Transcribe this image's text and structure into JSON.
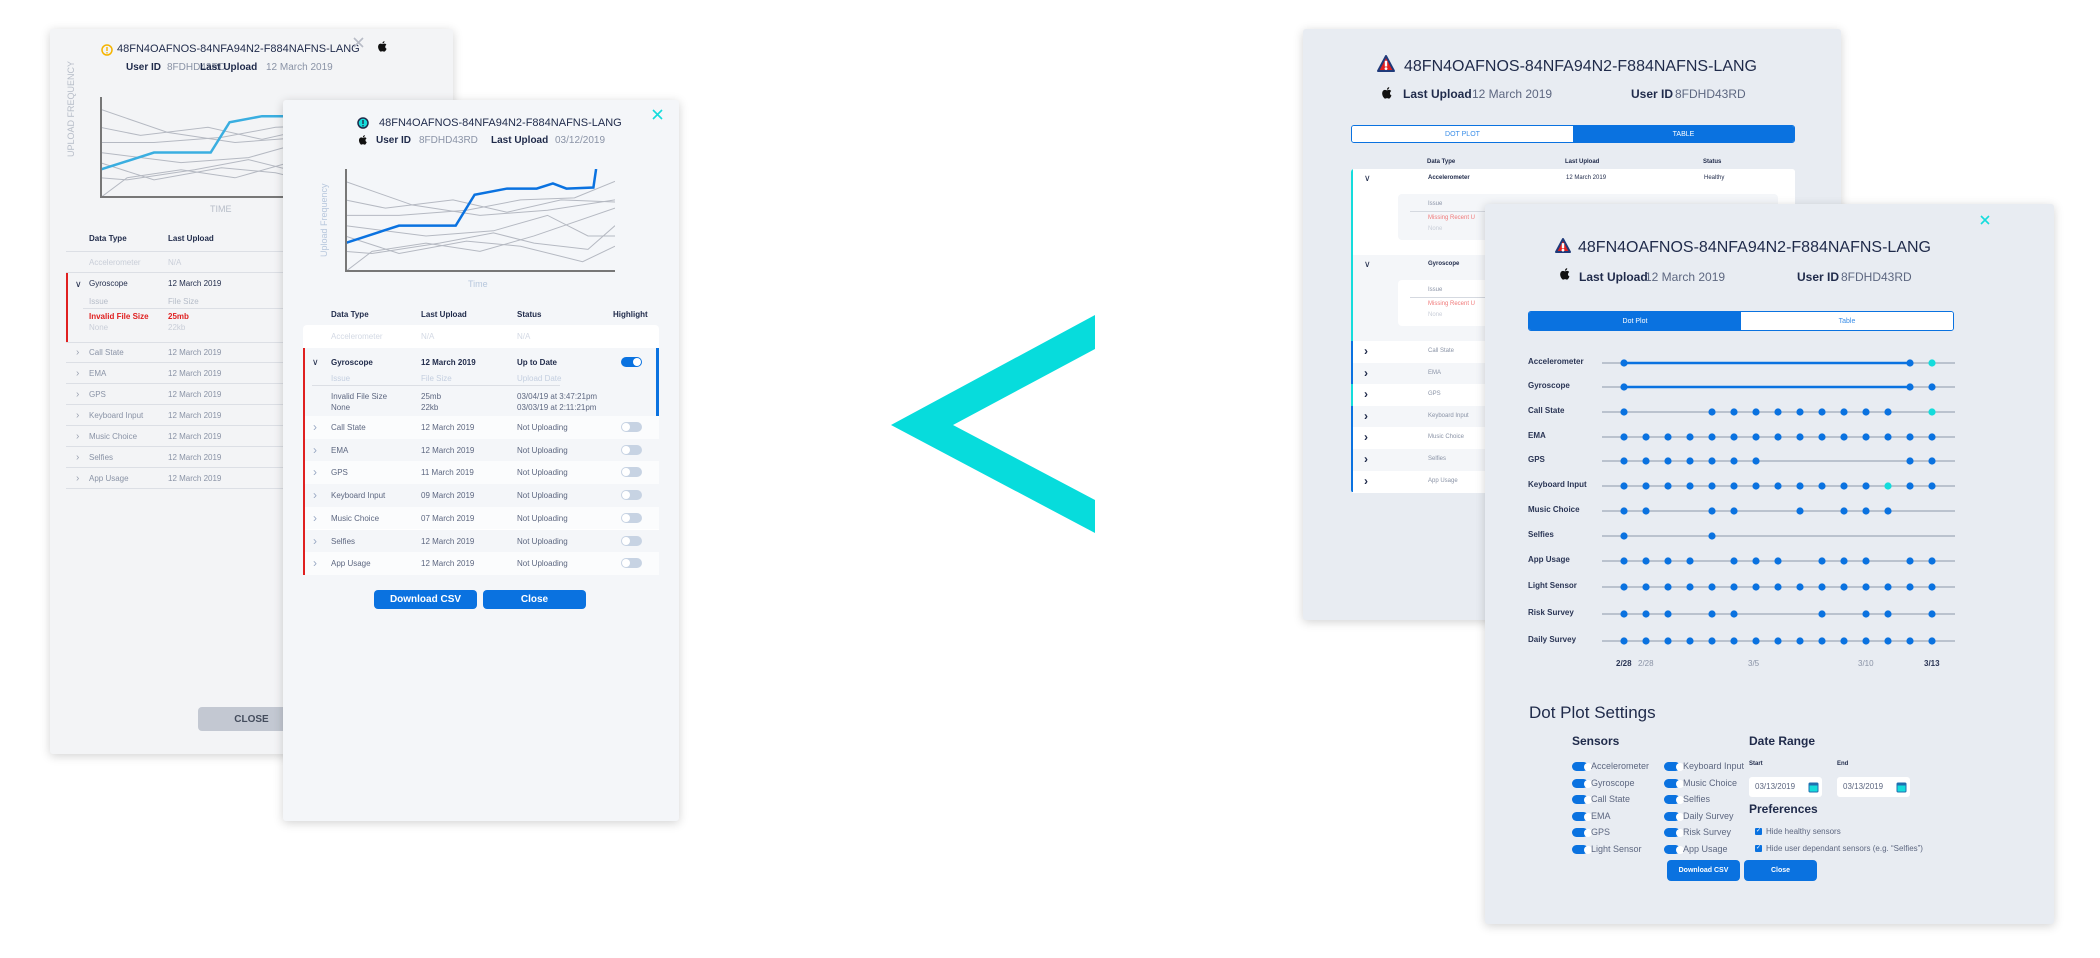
{
  "colors": {
    "accent": "#0a72e0",
    "teal": "#14dcdc",
    "error": "#e02020",
    "warning": "#f5b400",
    "navy": "#1f2a4a"
  },
  "old_design": {
    "back_card": {
      "device_id": "48FN4OAFNOS-84NFA94N2-F884NAFNS-LANG",
      "status_icon": "warning-circle-icon",
      "os_icon": "apple-icon",
      "user_id_label": "User ID",
      "user_id": "8FDHD43RD",
      "last_upload_label": "Last Upload",
      "last_upload": "12 March 2019",
      "chart_ylabel": "UPLOAD FREQUENCY",
      "chart_xlabel": "TIME",
      "columns": [
        "Data Type",
        "Last Upload"
      ],
      "disabled_row": {
        "type": "Accelerometer",
        "last_upload": "N/A"
      },
      "expanded_row": {
        "type": "Gyroscope",
        "last_upload": "12 March 2019",
        "sub_headers": [
          "Issue",
          "File Size"
        ],
        "details": [
          {
            "issue": "Invalid File Size",
            "size": "25mb"
          },
          {
            "issue": "None",
            "size": "22kb"
          }
        ]
      },
      "rows": [
        {
          "type": "Call State",
          "last_upload": "12 March 2019"
        },
        {
          "type": "EMA",
          "last_upload": "12 March 2019"
        },
        {
          "type": "GPS",
          "last_upload": "12 March 2019"
        },
        {
          "type": "Keyboard Input",
          "last_upload": "12 March 2019"
        },
        {
          "type": "Music Choice",
          "last_upload": "12 March 2019"
        },
        {
          "type": "Selfies",
          "last_upload": "12 March 2019"
        },
        {
          "type": "App Usage",
          "last_upload": "12 March 2019"
        }
      ],
      "close_label": "CLOSE"
    },
    "front_card": {
      "device_id": "48FN4OAFNOS-84NFA94N2-F884NAFNS-LANG",
      "status_icon": "alert-circle-icon",
      "os_icon": "apple-icon",
      "user_id_label": "User ID",
      "user_id": "8FDHD43RD",
      "last_upload_label": "Last Upload",
      "last_upload": "03/12/2019",
      "columns": [
        "Data Type",
        "Last Upload",
        "Status",
        "Highlight"
      ],
      "disabled_row": {
        "type": "Accelerometer",
        "last_upload": "N/A",
        "status": "N/A"
      },
      "expanded_row": {
        "type": "Gyroscope",
        "last_upload": "12 March 2019",
        "status": "Up to Date",
        "highlight": true,
        "sub_headers": [
          "Issue",
          "File Size",
          "Upload Date"
        ],
        "details": [
          {
            "issue": "Invalid File Size",
            "size": "25mb",
            "date": "03/04/19 at 3:47:21pm"
          },
          {
            "issue": "None",
            "size": "22kb",
            "date": "03/03/19 at 2:11:21pm"
          }
        ]
      },
      "rows": [
        {
          "type": "Call State",
          "last_upload": "12 March 2019",
          "status": "Not Uploading",
          "highlight": false
        },
        {
          "type": "EMA",
          "last_upload": "12 March 2019",
          "status": "Not Uploading",
          "highlight": false
        },
        {
          "type": "GPS",
          "last_upload": "11 March 2019",
          "status": "Not Uploading",
          "highlight": false
        },
        {
          "type": "Keyboard Input",
          "last_upload": "09 March 2019",
          "status": "Not Uploading",
          "highlight": false
        },
        {
          "type": "Music Choice",
          "last_upload": "07 March 2019",
          "status": "Not Uploading",
          "highlight": false
        },
        {
          "type": "Selfies",
          "last_upload": "12 March 2019",
          "status": "Not Uploading",
          "highlight": false
        },
        {
          "type": "App Usage",
          "last_upload": "12 March 2019",
          "status": "Not Uploading",
          "highlight": false
        }
      ],
      "download_label": "Download CSV",
      "close_label": "Close"
    }
  },
  "comparison_icon": "chevron-left-icon",
  "new_design": {
    "back_card": {
      "device_id": "48FN4OAFNOS-84NFA94N2-F884NAFNS-LANG",
      "status_icon": "warning-triangle-icon",
      "os_icon": "apple-icon",
      "last_upload_label": "Last Upload",
      "last_upload": "12 March 2019",
      "user_id_label": "User ID",
      "user_id": "8FDHD43RD",
      "tabs": [
        {
          "label": "DOT PLOT",
          "active": false
        },
        {
          "label": "TABLE",
          "active": true
        }
      ],
      "columns": [
        "Data Type",
        "Last Upload",
        "Status"
      ],
      "expanded_rows": [
        {
          "type": "Accelerometer",
          "last_upload": "12 March 2019",
          "status": "Healthy",
          "issue_header": "Issue",
          "issue": "Missing Recent U",
          "issue2": "None"
        },
        {
          "type": "Gyroscope",
          "issue_header": "Issue",
          "issue": "Missing Recent U",
          "issue2": "None"
        }
      ],
      "rows": [
        "Call State",
        "EMA",
        "GPS",
        "Keyboard Input",
        "Music Choice",
        "Selfies",
        "App Usage"
      ]
    },
    "front_card": {
      "device_id": "48FN4OAFNOS-84NFA94N2-F884NAFNS-LANG",
      "status_icon": "warning-triangle-icon",
      "os_icon": "apple-icon",
      "last_upload_label": "Last Upload",
      "last_upload": "12 March 2019",
      "user_id_label": "User ID",
      "user_id": "8FDHD43RD",
      "tabs": [
        {
          "label": "Dot Plot",
          "active": true
        },
        {
          "label": "Table",
          "active": false
        }
      ],
      "settings": {
        "title": "Dot Plot Settings",
        "sensors_title": "Sensors",
        "sensors": [
          {
            "label": "Accelerometer",
            "on": true
          },
          {
            "label": "Gyroscope",
            "on": true
          },
          {
            "label": "Call State",
            "on": true
          },
          {
            "label": "EMA",
            "on": true
          },
          {
            "label": "GPS",
            "on": true
          },
          {
            "label": "Light Sensor",
            "on": true
          },
          {
            "label": "Keyboard Input",
            "on": true
          },
          {
            "label": "Music Choice",
            "on": true
          },
          {
            "label": "Selfies",
            "on": true
          },
          {
            "label": "Daily Survey",
            "on": true
          },
          {
            "label": "Risk Survey",
            "on": true
          },
          {
            "label": "App Usage",
            "on": true
          }
        ],
        "date_range_title": "Date Range",
        "start_label": "Start",
        "start_value": "03/13/2019",
        "end_label": "End",
        "end_value": "03/13/2019",
        "preferences_title": "Preferences",
        "preferences": [
          {
            "label": "Hide healthy sensors",
            "checked": true
          },
          {
            "label": "Hide user dependant sensors (e.g. “Selfies”)",
            "checked": true
          }
        ]
      },
      "download_label": "Download CSV",
      "close_label": "Close"
    }
  },
  "chart_data": [
    {
      "type": "line",
      "xlabel": "Time",
      "ylabel": "Upload Frequency",
      "highlight_series": [
        [
          0,
          28
        ],
        [
          20,
          45
        ],
        [
          41,
          45
        ],
        [
          48,
          75
        ],
        [
          60,
          81
        ],
        [
          71,
          81
        ],
        [
          77,
          86
        ],
        [
          82,
          81
        ],
        [
          92,
          82
        ],
        [
          93,
          100
        ]
      ],
      "series": [
        [
          [
            0,
            88
          ],
          [
            25,
            65
          ],
          [
            50,
            55
          ],
          [
            75,
            60
          ],
          [
            100,
            70
          ]
        ],
        [
          [
            0,
            70
          ],
          [
            15,
            62
          ],
          [
            40,
            70
          ],
          [
            60,
            58
          ],
          [
            80,
            70
          ],
          [
            100,
            68
          ]
        ],
        [
          [
            0,
            55
          ],
          [
            20,
            55
          ],
          [
            45,
            60
          ],
          [
            65,
            70
          ],
          [
            85,
            72
          ],
          [
            100,
            88
          ]
        ],
        [
          [
            0,
            45
          ],
          [
            30,
            35
          ],
          [
            55,
            40
          ],
          [
            75,
            55
          ],
          [
            90,
            35
          ],
          [
            100,
            35
          ]
        ],
        [
          [
            0,
            35
          ],
          [
            20,
            18
          ],
          [
            45,
            30
          ],
          [
            65,
            25
          ],
          [
            88,
            10
          ],
          [
            100,
            25
          ]
        ],
        [
          [
            0,
            20
          ],
          [
            10,
            18
          ],
          [
            35,
            28
          ],
          [
            55,
            38
          ],
          [
            70,
            28
          ],
          [
            90,
            22
          ],
          [
            100,
            45
          ]
        ],
        [
          [
            0,
            0
          ],
          [
            10,
            20
          ],
          [
            30,
            28
          ],
          [
            50,
            20
          ],
          [
            70,
            35
          ],
          [
            100,
            62
          ]
        ]
      ]
    },
    {
      "type": "scatter",
      "x_tick_labels": [
        {
          "index": 0,
          "label": "2/28",
          "bold": true
        },
        {
          "index": 1,
          "label": "2/28",
          "bold": false
        },
        {
          "index": 6,
          "label": "3/5",
          "bold": false
        },
        {
          "index": 11,
          "label": "3/10",
          "bold": false
        },
        {
          "index": 14,
          "label": "3/13",
          "bold": true
        }
      ],
      "x_count": 15,
      "rows": [
        {
          "label": "Accelerometer",
          "dots": [
            0,
            13,
            14
          ],
          "continuous": [
            0,
            13
          ],
          "teal": [
            14
          ]
        },
        {
          "label": "Gyroscope",
          "dots": [
            0,
            13,
            14
          ],
          "continuous": [
            0,
            13
          ],
          "teal": []
        },
        {
          "label": "Call State",
          "dots": [
            0,
            4,
            5,
            6,
            7,
            8,
            9,
            10,
            11,
            12,
            14
          ],
          "teal": [
            14
          ]
        },
        {
          "label": "EMA",
          "dots": [
            0,
            1,
            2,
            3,
            4,
            5,
            6,
            7,
            8,
            9,
            10,
            11,
            12,
            13,
            14
          ],
          "teal": []
        },
        {
          "label": "GPS",
          "dots": [
            0,
            1,
            2,
            3,
            4,
            5,
            6,
            13,
            14
          ],
          "teal": []
        },
        {
          "label": "Keyboard Input",
          "dots": [
            0,
            1,
            2,
            3,
            4,
            5,
            6,
            7,
            8,
            9,
            10,
            11,
            12,
            13,
            14
          ],
          "teal": [
            12
          ]
        },
        {
          "label": "Music Choice",
          "dots": [
            0,
            1,
            4,
            5,
            8,
            10,
            11,
            12
          ],
          "teal": []
        },
        {
          "label": "Selfies",
          "dots": [
            0,
            4
          ],
          "teal": []
        },
        {
          "label": "App Usage",
          "dots": [
            0,
            1,
            2,
            3,
            5,
            6,
            7,
            9,
            10,
            11,
            13,
            14
          ],
          "teal": []
        },
        {
          "label": "Light Sensor",
          "dots": [
            0,
            1,
            2,
            3,
            4,
            5,
            6,
            7,
            8,
            9,
            10,
            11,
            12,
            13,
            14
          ],
          "teal": []
        },
        {
          "label": "Risk Survey",
          "dots": [
            0,
            1,
            2,
            4,
            5,
            9,
            11,
            12,
            14
          ],
          "teal": []
        },
        {
          "label": "Daily Survey",
          "dots": [
            0,
            1,
            2,
            3,
            4,
            5,
            6,
            7,
            8,
            9,
            10,
            11,
            12,
            13,
            14
          ],
          "teal": []
        }
      ]
    }
  ]
}
